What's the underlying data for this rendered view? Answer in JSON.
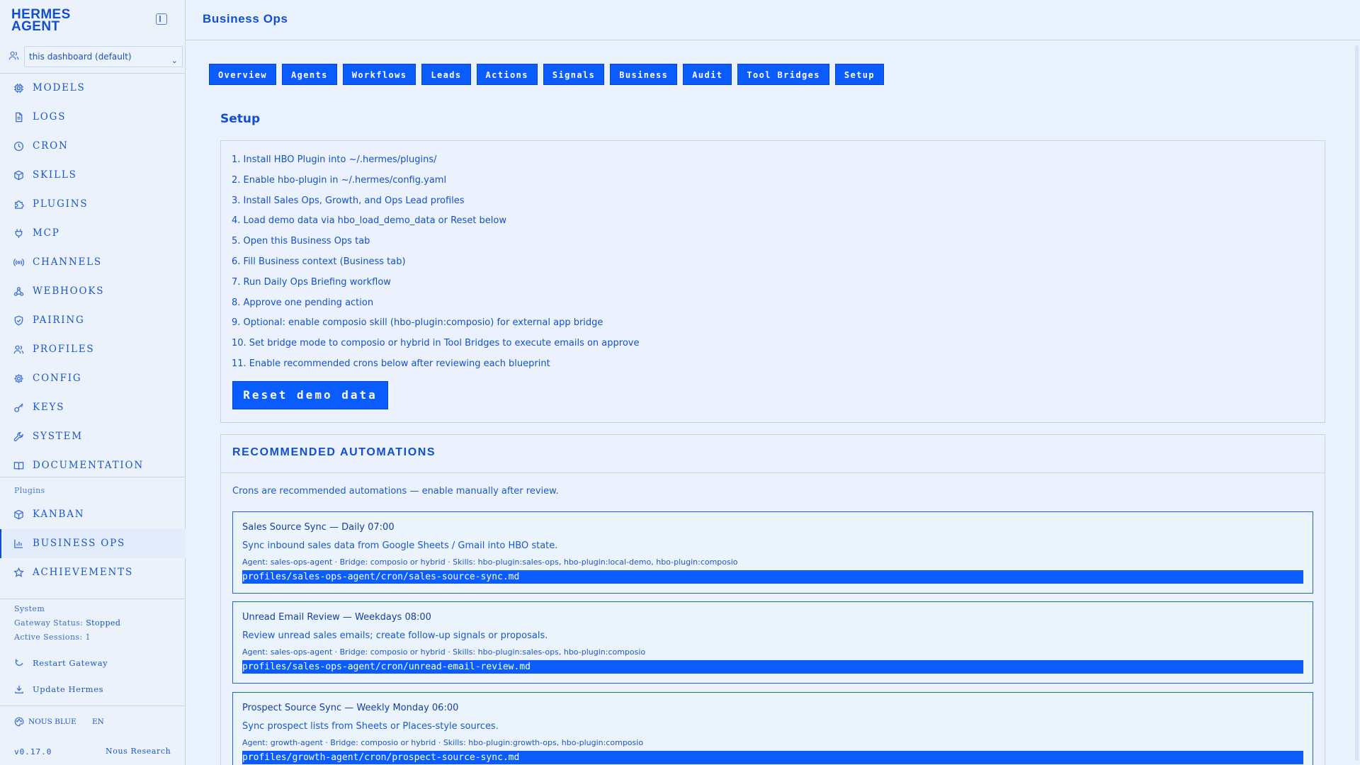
{
  "sidebar": {
    "brand": "HERMES\nAGENT",
    "profile_select": "this dashboard (default)",
    "nav": [
      {
        "label": "MODELS",
        "icon": "cpu-icon"
      },
      {
        "label": "LOGS",
        "icon": "file-text-icon"
      },
      {
        "label": "CRON",
        "icon": "clock-icon"
      },
      {
        "label": "SKILLS",
        "icon": "package-icon"
      },
      {
        "label": "PLUGINS",
        "icon": "puzzle-icon"
      },
      {
        "label": "MCP",
        "icon": "plug-icon"
      },
      {
        "label": "CHANNELS",
        "icon": "radio-icon"
      },
      {
        "label": "WEBHOOKS",
        "icon": "webhook-icon"
      },
      {
        "label": "PAIRING",
        "icon": "shield-check-icon"
      },
      {
        "label": "PROFILES",
        "icon": "users-icon"
      },
      {
        "label": "CONFIG",
        "icon": "gear-icon"
      },
      {
        "label": "KEYS",
        "icon": "key-icon"
      },
      {
        "label": "SYSTEM",
        "icon": "wrench-icon"
      },
      {
        "label": "DOCUMENTATION",
        "icon": "book-icon"
      }
    ],
    "plugins_label": "Plugins",
    "plugin_nav": [
      {
        "label": "KANBAN",
        "icon": "package-icon"
      },
      {
        "label": "BUSINESS OPS",
        "icon": "bar-chart-icon"
      },
      {
        "label": "ACHIEVEMENTS",
        "icon": "star-icon"
      }
    ],
    "system": {
      "label": "System",
      "gateway_status_label": "Gateway Status:",
      "gateway_status_value": "Stopped",
      "active_sessions": "Active Sessions: 1",
      "restart": "Restart Gateway",
      "update": "Update Hermes"
    },
    "theme": "NOUS BLUE",
    "lang": "EN",
    "version": "v0.17.0",
    "vendor": "Nous Research"
  },
  "header": {
    "title": "Business Ops"
  },
  "tabs": [
    "Overview",
    "Agents",
    "Workflows",
    "Leads",
    "Actions",
    "Signals",
    "Business",
    "Audit",
    "Tool Bridges",
    "Setup"
  ],
  "setup": {
    "title": "Setup",
    "steps": [
      "1. Install HBO Plugin into ~/.hermes/plugins/",
      "2. Enable hbo-plugin in ~/.hermes/config.yaml",
      "3. Install Sales Ops, Growth, and Ops Lead profiles",
      "4. Load demo data via hbo_load_demo_data or Reset below",
      "5. Open this Business Ops tab",
      "6. Fill Business context (Business tab)",
      "7. Run Daily Ops Briefing workflow",
      "8. Approve one pending action",
      "9. Optional: enable composio skill (hbo-plugin:composio) for external app bridge",
      "10. Set bridge mode to composio or hybrid in Tool Bridges to execute emails on approve",
      "11. Enable recommended crons below after reviewing each blueprint"
    ],
    "reset_label": "Reset demo data"
  },
  "automations": {
    "title": "RECOMMENDED AUTOMATIONS",
    "note": "Crons are recommended automations — enable manually after review.",
    "items": [
      {
        "title": "Sales Source Sync — Daily 07:00",
        "desc": "Sync inbound sales data from Google Sheets / Gmail into HBO state.",
        "meta": "Agent: sales-ops-agent · Bridge: composio or hybrid · Skills: hbo-plugin:sales-ops, hbo-plugin:local-demo, hbo-plugin:composio",
        "path": "profiles/sales-ops-agent/cron/sales-source-sync.md"
      },
      {
        "title": "Unread Email Review — Weekdays 08:00",
        "desc": "Review unread sales emails; create follow-up signals or proposals.",
        "meta": "Agent: sales-ops-agent · Bridge: composio or hybrid · Skills: hbo-plugin:sales-ops, hbo-plugin:composio",
        "path": "profiles/sales-ops-agent/cron/unread-email-review.md"
      },
      {
        "title": "Prospect Source Sync — Weekly Monday 06:00",
        "desc": "Sync prospect lists from Sheets or Places-style sources.",
        "meta": "Agent: growth-agent · Bridge: composio or hybrid · Skills: hbo-plugin:growth-ops, hbo-plugin:composio",
        "path": "profiles/growth-agent/cron/prospect-source-sync.md"
      }
    ]
  },
  "colors": {
    "accent": "#0a5cff",
    "text": "#0f4fd0",
    "background": "#e9f1fc",
    "border": "#c4d6f1"
  }
}
